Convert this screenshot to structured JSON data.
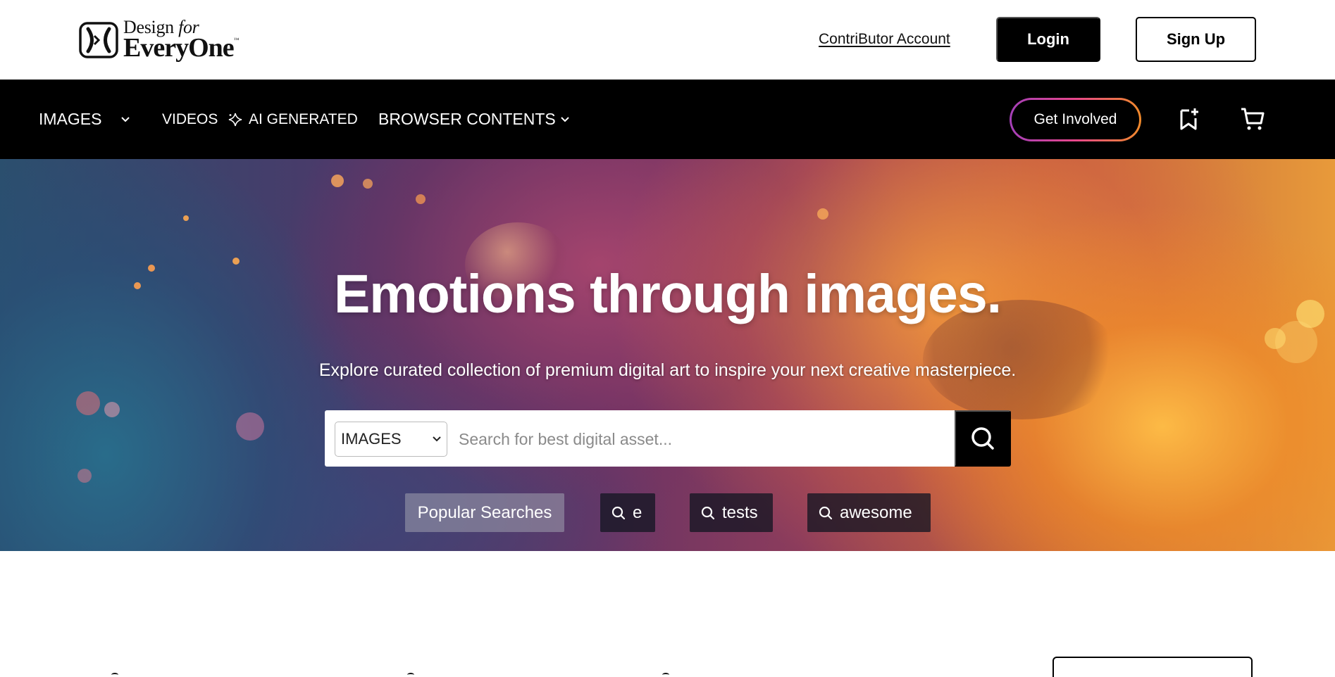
{
  "brand": {
    "logo_line1_a": "Design ",
    "logo_line1_b": "for",
    "logo_line2": "EveryOne",
    "logo_tm": "™"
  },
  "header": {
    "contributor_link": "ContriButor Account",
    "login_label": "Login",
    "signup_label": "Sign Up"
  },
  "nav": {
    "items": [
      {
        "label": "IMAGES",
        "icon": "chevron-down-icon"
      },
      {
        "label": "VIDEOS"
      },
      {
        "label": "AI GENERATED",
        "icon": "sparkle-icon"
      },
      {
        "label": "BROWSER CONTENTS",
        "icon": "chevron-down-icon"
      }
    ],
    "get_involved_label": "Get Involved",
    "icons": [
      "bookmark-add-icon",
      "cart-icon"
    ]
  },
  "hero": {
    "title": "Emotions through images.",
    "subtitle": "Explore curated collection of premium digital art to inspire your next creative masterpiece.",
    "search": {
      "category_selected": "IMAGES",
      "placeholder": "Search for best digital asset...",
      "value": ""
    },
    "popular_label": "Popular Searches",
    "popular_terms": [
      "e",
      "tests",
      "awesome"
    ]
  },
  "colors": {
    "nav_background": "#000000",
    "get_involved_gradient": [
      "#a43fb8",
      "#e8478b",
      "#f08a2a"
    ],
    "primary_button": "#000000"
  }
}
